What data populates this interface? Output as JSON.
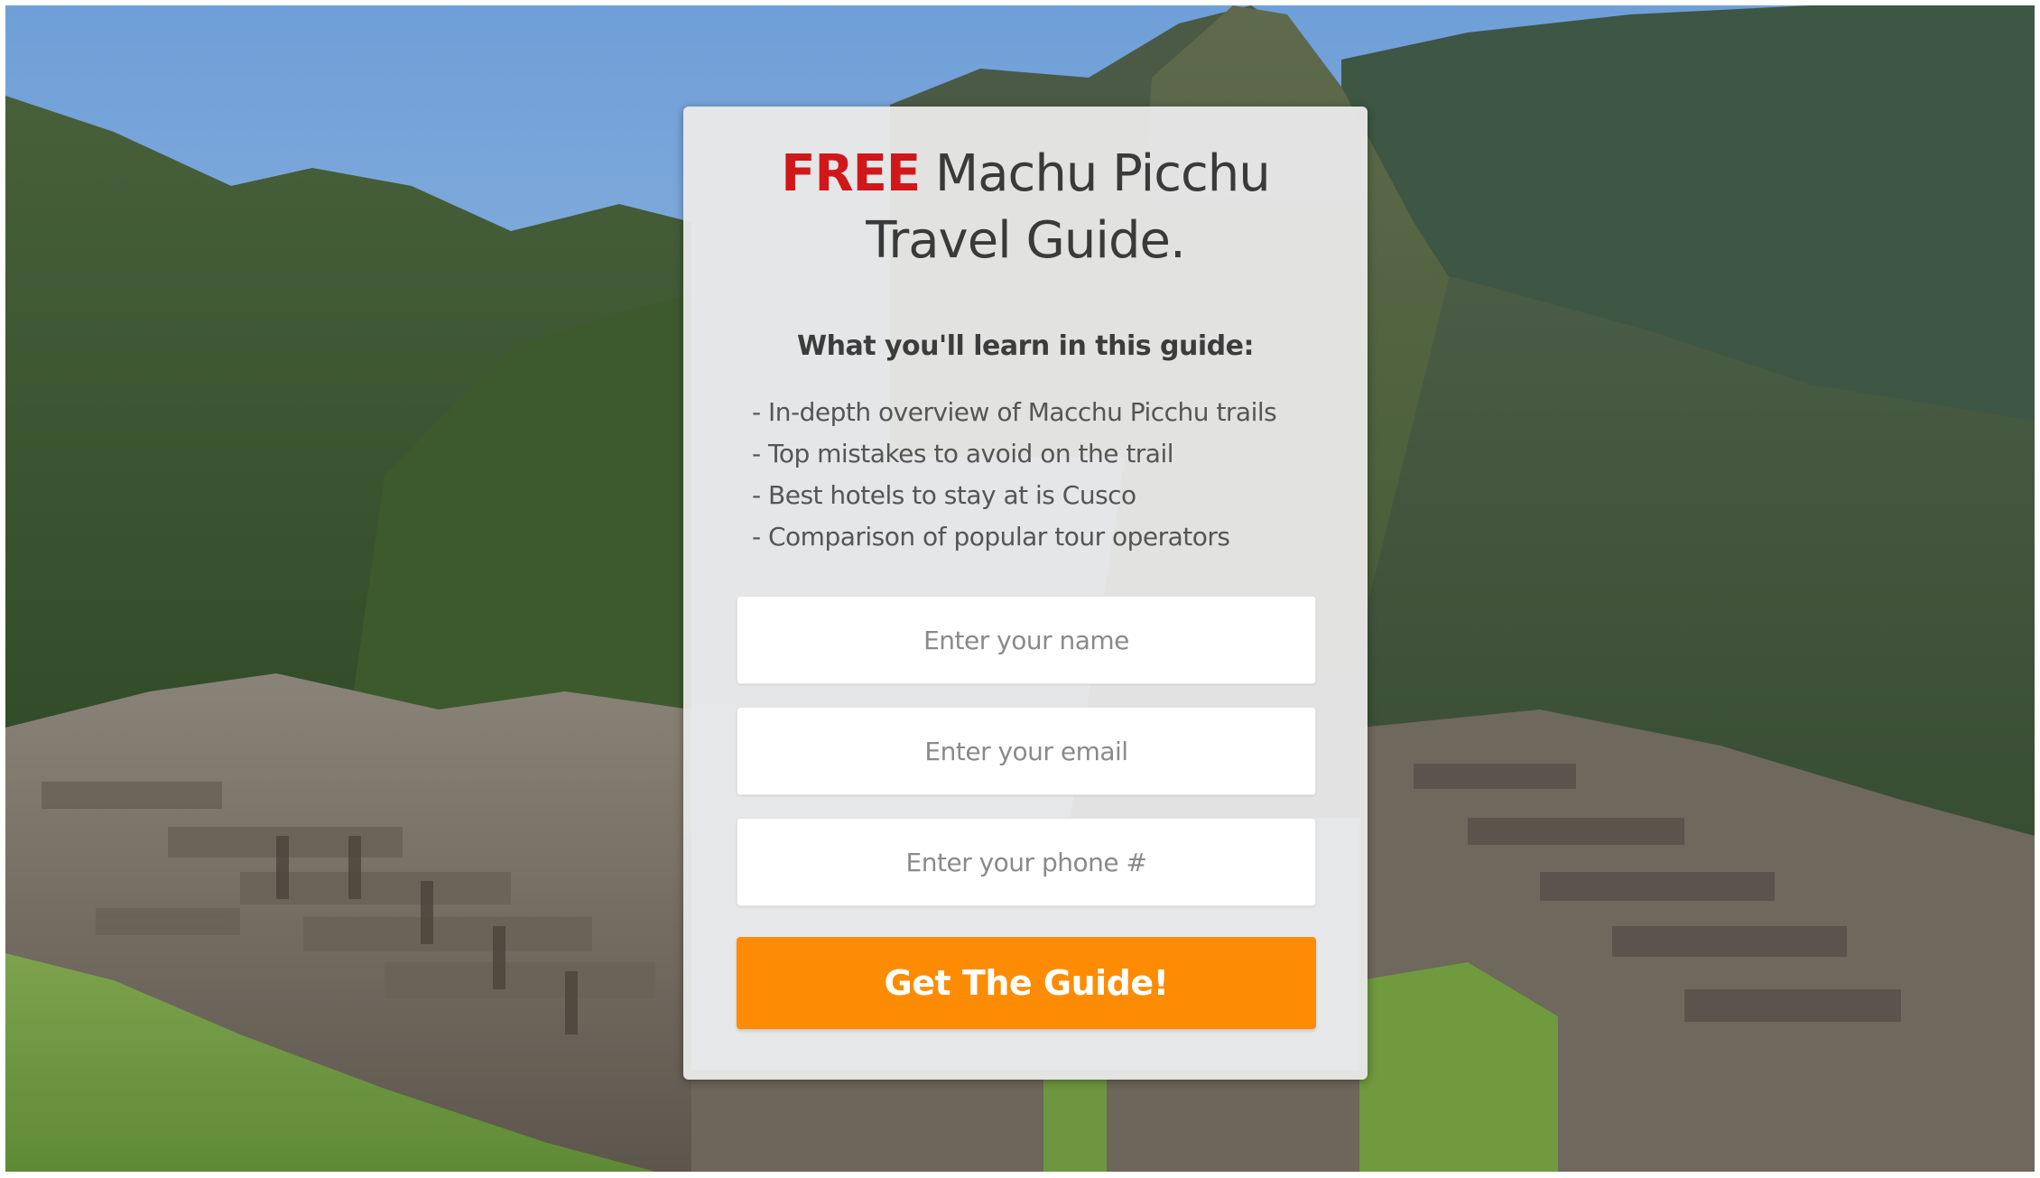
{
  "form": {
    "headline_highlight": "FREE",
    "headline_line1_rest": "Machu Picchu",
    "headline_line2": "Travel Guide.",
    "subheading": "What you'll learn in this guide:",
    "bullets": [
      "- In-depth overview of Macchu Picchu trails",
      "- Top mistakes to avoid on the trail",
      "- Best hotels to stay at is Cusco",
      "- Comparison of popular tour operators"
    ],
    "name_placeholder": "Enter your name",
    "email_placeholder": "Enter your email",
    "phone_placeholder": "Enter your phone #",
    "submit_label": "Get The Guide!"
  },
  "colors": {
    "highlight_red": "#d0181b",
    "cta_orange": "#fd8c04",
    "card_bg": "#e8e8e8"
  }
}
